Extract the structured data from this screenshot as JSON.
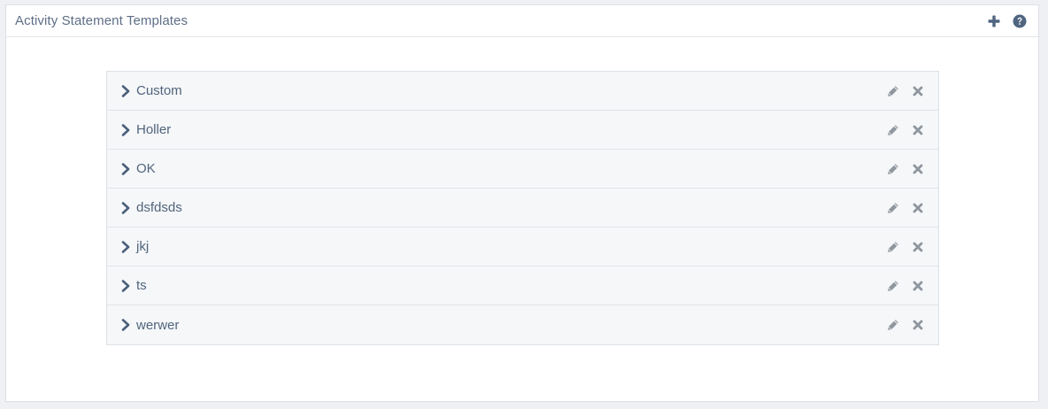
{
  "panel": {
    "title": "Activity Statement Templates",
    "add_icon": "plus-icon",
    "help_icon": "question-circle-icon"
  },
  "templates": [
    {
      "label": "Custom"
    },
    {
      "label": "Holler"
    },
    {
      "label": "OK"
    },
    {
      "label": "dsfdsds"
    },
    {
      "label": "jkj"
    },
    {
      "label": "ts"
    },
    {
      "label": "werwer"
    }
  ],
  "row_icons": {
    "expand": "chevron-right-icon",
    "edit": "pencil-icon",
    "delete": "close-icon"
  },
  "colors": {
    "header_icon": "#4f6580",
    "chevron": "#4a5f7a",
    "row_action": "#8f969e",
    "text": "#51647c"
  }
}
